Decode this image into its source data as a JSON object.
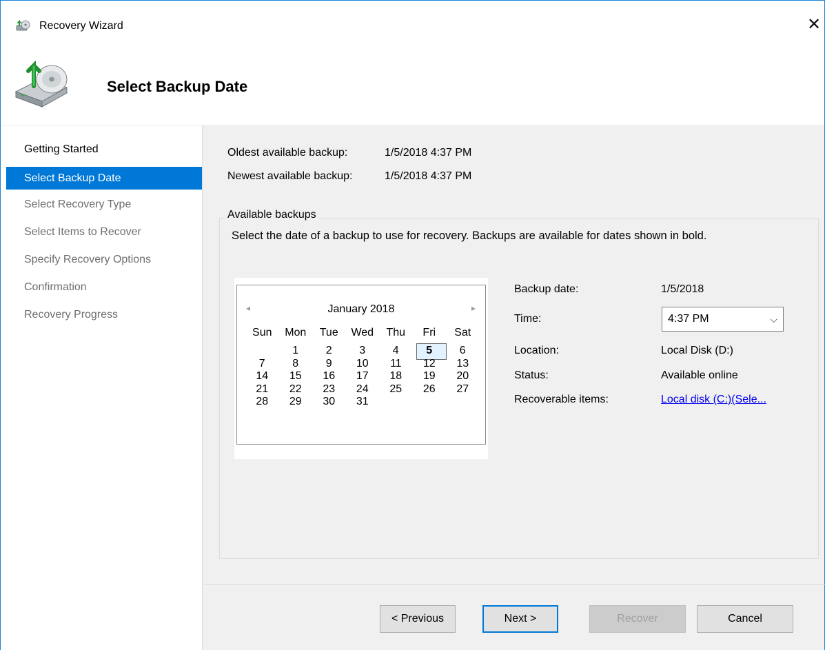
{
  "window": {
    "title": "Recovery Wizard",
    "close": "✕"
  },
  "header": {
    "title": "Select Backup Date"
  },
  "sidebar": {
    "items": [
      {
        "label": "Getting Started"
      },
      {
        "label": "Select Backup Date"
      },
      {
        "label": "Select Recovery Type"
      },
      {
        "label": "Select Items to Recover"
      },
      {
        "label": "Specify Recovery Options"
      },
      {
        "label": "Confirmation"
      },
      {
        "label": "Recovery Progress"
      }
    ],
    "active_index": 1
  },
  "info": {
    "oldest_label": "Oldest available backup:",
    "oldest_value": "1/5/2018 4:37 PM",
    "newest_label": "Newest available backup:",
    "newest_value": "1/5/2018 4:37 PM"
  },
  "available": {
    "group_title": "Available backups",
    "description": "Select the date of a backup to use for recovery. Backups are available for dates shown in bold."
  },
  "calendar": {
    "prev": "◂",
    "next": "▸",
    "month": "January 2018",
    "weekdays": [
      "Sun",
      "Mon",
      "Tue",
      "Wed",
      "Thu",
      "Fri",
      "Sat"
    ],
    "weeks": [
      [
        "",
        "1",
        "2",
        "3",
        "4",
        "5",
        "6"
      ],
      [
        "7",
        "8",
        "9",
        "10",
        "11",
        "12",
        "13"
      ],
      [
        "14",
        "15",
        "16",
        "17",
        "18",
        "19",
        "20"
      ],
      [
        "21",
        "22",
        "23",
        "24",
        "25",
        "26",
        "27"
      ],
      [
        "28",
        "29",
        "30",
        "31",
        "",
        "",
        ""
      ]
    ],
    "selected_day": "5",
    "bold_days": [
      "5"
    ]
  },
  "properties": {
    "backup_date_label": "Backup date:",
    "backup_date_value": "1/5/2018",
    "time_label": "Time:",
    "time_value": "4:37 PM",
    "location_label": "Location:",
    "location_value": "Local Disk (D:)",
    "status_label": "Status:",
    "status_value": "Available online",
    "recoverable_label": "Recoverable items:",
    "recoverable_value": "Local disk (C:)(Sele..."
  },
  "buttons": {
    "previous": "< Previous",
    "next": "Next >",
    "recover": "Recover",
    "cancel": "Cancel"
  },
  "colors": {
    "accent": "#0078d7",
    "content_bg": "#f0f0f0",
    "link": "#0000ee"
  },
  "icons": {
    "app": "recovery-wizard-icon",
    "header": "backup-drive-recovery-icon",
    "dropdown": "chevron-down-icon"
  }
}
